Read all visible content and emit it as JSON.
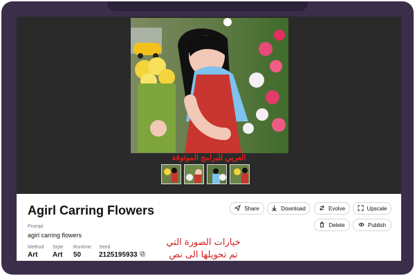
{
  "watermark": "العربي للبرامج الموثوقة",
  "title": "Agirl Carring Flowers",
  "prompt": {
    "label": "Prompt",
    "value": "agirl carring flowers"
  },
  "meta": [
    {
      "label": "Method",
      "value": "Art"
    },
    {
      "label": "Style",
      "value": "Art"
    },
    {
      "label": "Runtime",
      "value": "50"
    },
    {
      "label": "Seed",
      "value": "2125195933"
    }
  ],
  "actions": {
    "share": "Share",
    "download": "Download",
    "evolve": "Evolve",
    "upscale": "Upscale",
    "delete": "Delete",
    "publish": "Publish"
  },
  "arabic_overlay": {
    "line1": "خيارات الصورة التي",
    "line2": "تم تحويلها الى نص"
  },
  "icons": [
    "share-icon",
    "download-icon",
    "evolve-icon",
    "upscale-icon",
    "delete-icon",
    "publish-icon",
    "copy-icon"
  ]
}
